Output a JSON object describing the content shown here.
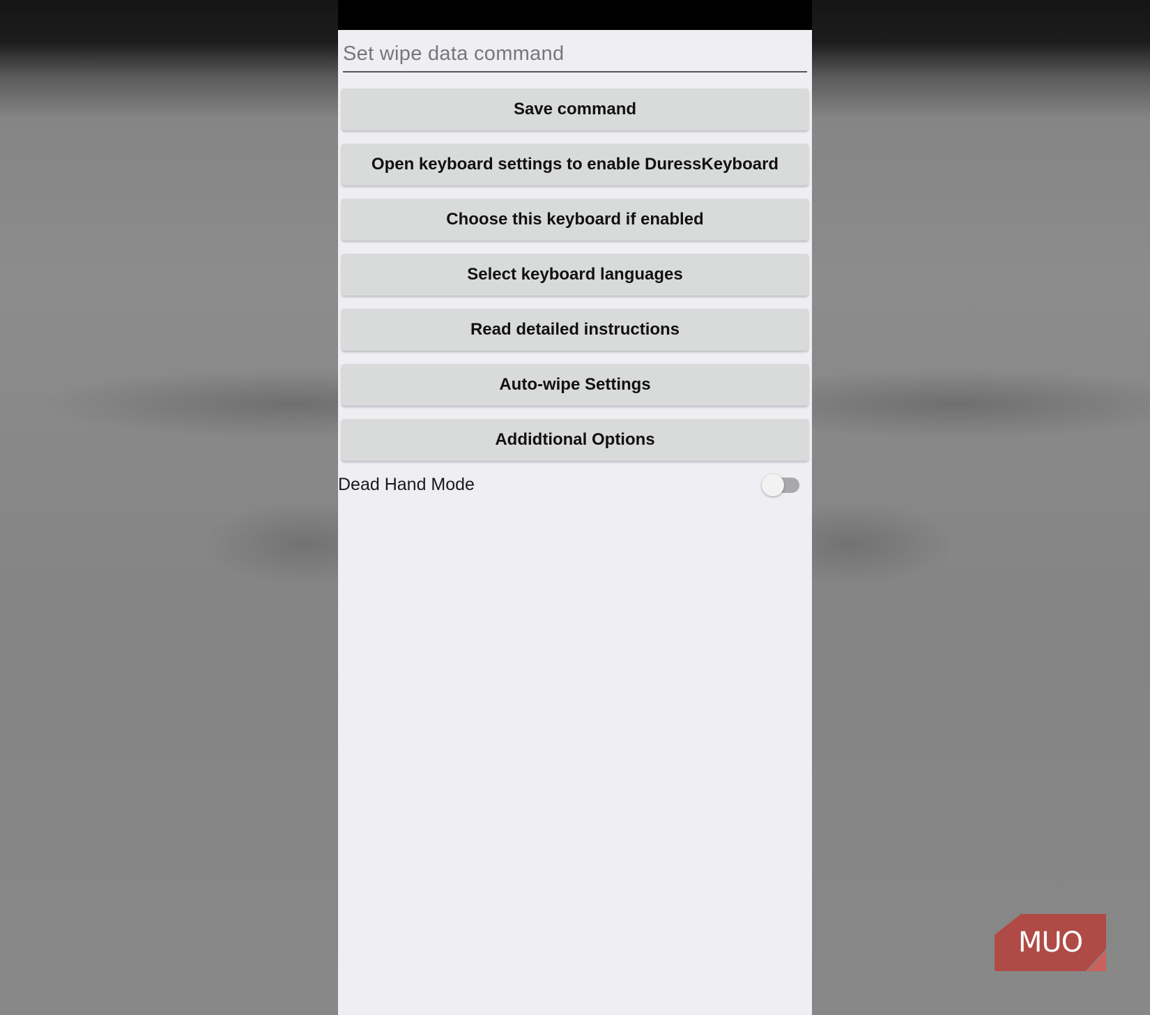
{
  "input": {
    "placeholder": "Set wipe data command",
    "value": ""
  },
  "buttons": [
    {
      "label": "Save command"
    },
    {
      "label": "Open keyboard settings to enable DuressKeyboard"
    },
    {
      "label": "Choose this keyboard if enabled"
    },
    {
      "label": "Select keyboard languages"
    },
    {
      "label": "Read detailed instructions"
    },
    {
      "label": "Auto-wipe Settings"
    },
    {
      "label": "Addidtional Options"
    }
  ],
  "dead_hand": {
    "label": "Dead Hand Mode",
    "enabled": false
  },
  "watermark": {
    "text": "MUO",
    "color": "#b04a46"
  }
}
